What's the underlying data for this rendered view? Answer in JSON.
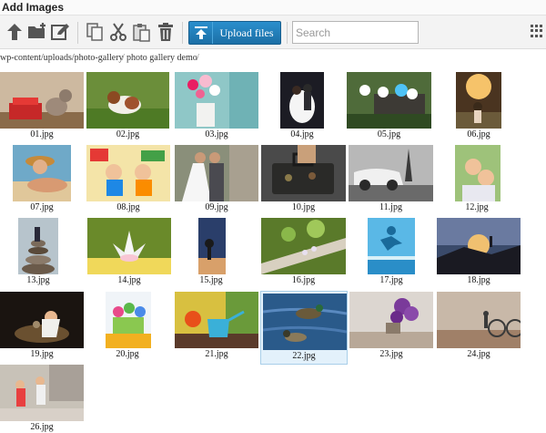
{
  "window": {
    "title": "Add Images"
  },
  "toolbar": {
    "upload_label": "Upload files",
    "search_placeholder": "Search",
    "icons": [
      "arrow-up-icon",
      "new-folder-icon",
      "edit-icon",
      "copy-icon",
      "cut-icon",
      "paste-icon",
      "trash-icon",
      "upload-icon",
      "grid-view-icon"
    ]
  },
  "breadcrumb": {
    "path": "wp-content/uploads/photo-gallery",
    "folder": "photo gallery demo",
    "separator": "/"
  },
  "colors": {
    "accent": "#1f7bb8",
    "selected_bg": "#e3f1fb",
    "selected_border": "#a9cfe9"
  },
  "images": [
    {
      "name": "01.jpg"
    },
    {
      "name": "02.jpg"
    },
    {
      "name": "03.jpg"
    },
    {
      "name": "04.jpg"
    },
    {
      "name": "05.jpg"
    },
    {
      "name": "06.jpg"
    },
    {
      "name": "07.jpg"
    },
    {
      "name": "08.jpg"
    },
    {
      "name": "09.jpg"
    },
    {
      "name": "10.jpg"
    },
    {
      "name": "11.jpg"
    },
    {
      "name": "12.jpg"
    },
    {
      "name": "13.jpg"
    },
    {
      "name": "14.jpg"
    },
    {
      "name": "15.jpg"
    },
    {
      "name": "16.jpg"
    },
    {
      "name": "17.jpg"
    },
    {
      "name": "18.jpg"
    },
    {
      "name": "19.jpg"
    },
    {
      "name": "20.jpg"
    },
    {
      "name": "21.jpg"
    },
    {
      "name": "22.jpg"
    },
    {
      "name": "23.jpg"
    },
    {
      "name": "24.jpg"
    },
    {
      "name": "26.jpg"
    }
  ]
}
